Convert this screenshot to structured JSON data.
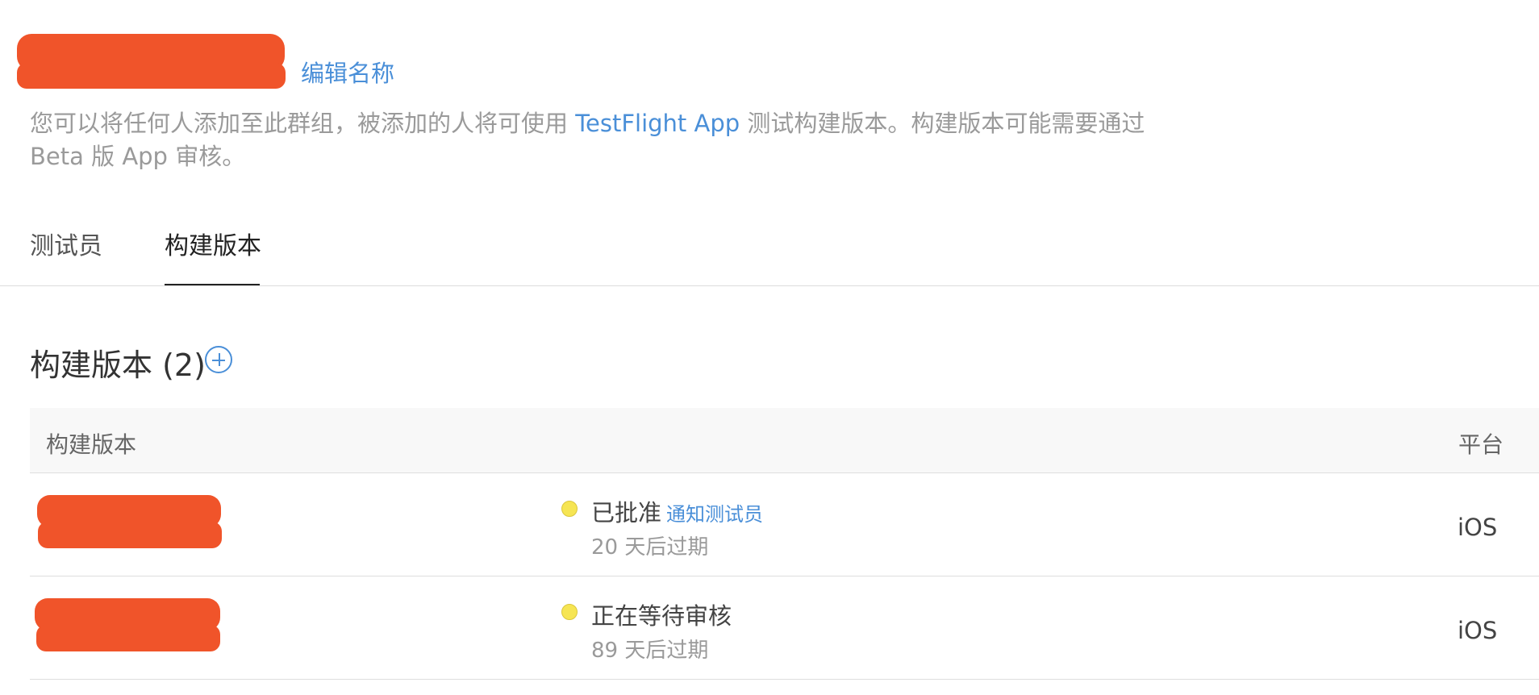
{
  "header": {
    "edit_name_label": "编辑名称",
    "description_before": "您可以将任何人添加至此群组，被添加的人将可使用 ",
    "description_link": "TestFlight App",
    "description_after": " 测试构建版本。构建版本可能需要通过 Beta 版 App 审核。"
  },
  "tabs": [
    {
      "label": "测试员",
      "active": false
    },
    {
      "label": "构建版本",
      "active": true
    }
  ],
  "section": {
    "title": "构建版本 (2)",
    "add_icon": "plus-circle-icon"
  },
  "table": {
    "columns": [
      "构建版本",
      "平台"
    ],
    "rows": [
      {
        "status": "已批准",
        "action": "通知测试员",
        "expiry": "20 天后过期",
        "platform": "iOS",
        "status_color": "#f6e553"
      },
      {
        "status": "正在等待审核",
        "action": "",
        "expiry": "89 天后过期",
        "platform": "iOS",
        "status_color": "#f6e553"
      }
    ]
  },
  "colors": {
    "accent": "#4a8fd8",
    "redaction": "#f0542a"
  }
}
